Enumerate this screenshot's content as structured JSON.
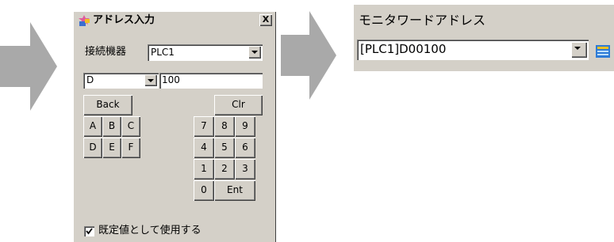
{
  "dialog": {
    "title": "アドレス入力",
    "close_label": "X",
    "device_label": "接続機器",
    "device_value": "PLC1",
    "address_type": "D",
    "address_value": "100",
    "keys": {
      "back": "Back",
      "clr": "Clr",
      "a": "A",
      "b": "B",
      "c": "C",
      "d": "D",
      "e": "E",
      "f": "F",
      "n7": "7",
      "n8": "8",
      "n9": "9",
      "n4": "4",
      "n5": "5",
      "n6": "6",
      "n1": "1",
      "n2": "2",
      "n3": "3",
      "n0": "0",
      "ent": "Ent"
    },
    "checkbox_label": "既定値として使用する",
    "checkbox_checked": true
  },
  "panel": {
    "label": "モニタワードアドレス",
    "value": "[PLC1]D00100"
  },
  "colors": {
    "arrow": "#a9a9a9",
    "face": "#d4d0c8",
    "monitor_icon": "#2e7bd6"
  },
  "icons": [
    "right-arrow-icon",
    "app-icon",
    "close-icon",
    "chevron-down-icon",
    "checkmark-icon",
    "monitor-icon"
  ]
}
